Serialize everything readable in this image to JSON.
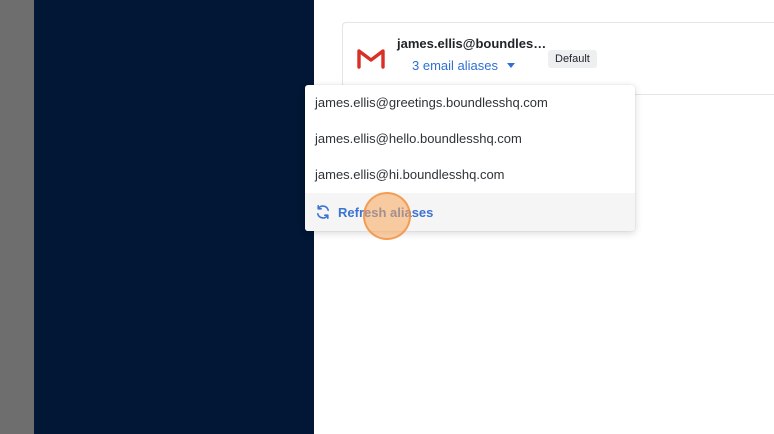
{
  "account": {
    "email": "james.ellis@boundles…",
    "aliases_toggle_label": "3 email aliases",
    "badge": "Default"
  },
  "dropdown": {
    "aliases": [
      "james.ellis@greetings.boundlesshq.com",
      "james.ellis@hello.boundlesshq.com",
      "james.ellis@hi.boundlesshq.com"
    ],
    "refresh_label": "Refresh aliases"
  },
  "colors": {
    "sidebar_navy": "#021635",
    "left_strip_gray": "#6e6e6e",
    "link_blue": "#2f6fd6",
    "gmail_red": "#d93025",
    "click_highlight": "#faa55a"
  },
  "icons": {
    "account_icon": "gmail-icon",
    "toggle_caret": "caret-down-icon",
    "refresh_icon": "refresh-icon"
  }
}
